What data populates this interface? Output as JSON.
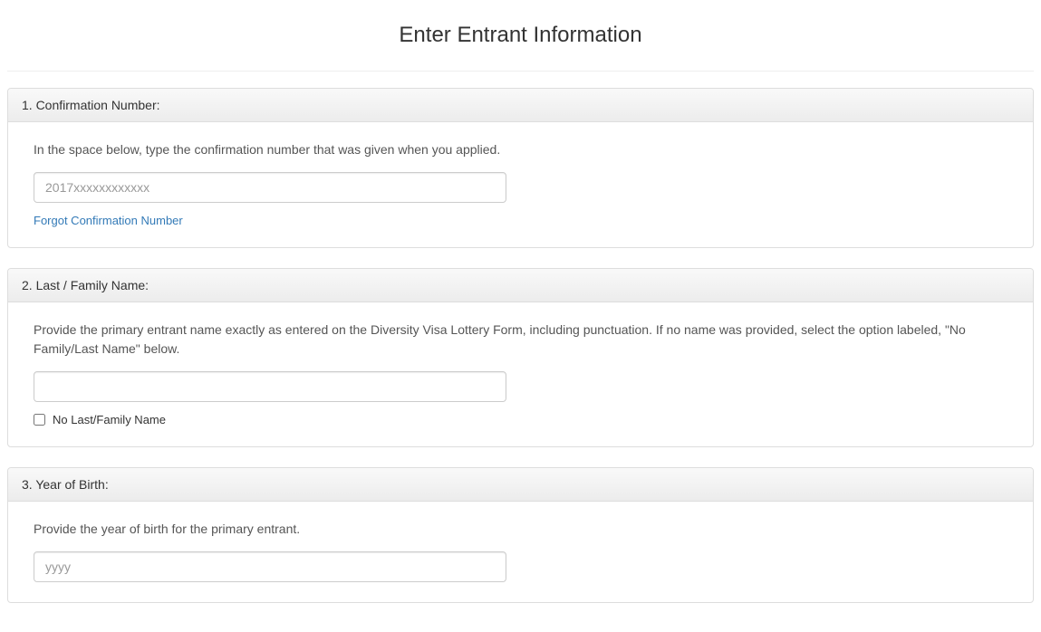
{
  "page": {
    "title": "Enter Entrant Information"
  },
  "sections": {
    "confirmation": {
      "heading": "1. Confirmation Number:",
      "instruction": "In the space below, type the confirmation number that was given when you applied.",
      "placeholder": "2017xxxxxxxxxxxx",
      "value": "",
      "forgot_link": "Forgot Confirmation Number"
    },
    "lastname": {
      "heading": "2. Last / Family Name:",
      "instruction": "Provide the primary entrant name exactly as entered on the Diversity Visa Lottery Form, including punctuation. If no name was provided, select the option labeled, \"No Family/Last Name\" below.",
      "value": "",
      "no_name_checkbox_label": "No Last/Family Name",
      "no_name_checked": false
    },
    "yob": {
      "heading": "3. Year of Birth:",
      "instruction": "Provide the year of birth for the primary entrant.",
      "placeholder": "yyyy",
      "value": ""
    }
  }
}
